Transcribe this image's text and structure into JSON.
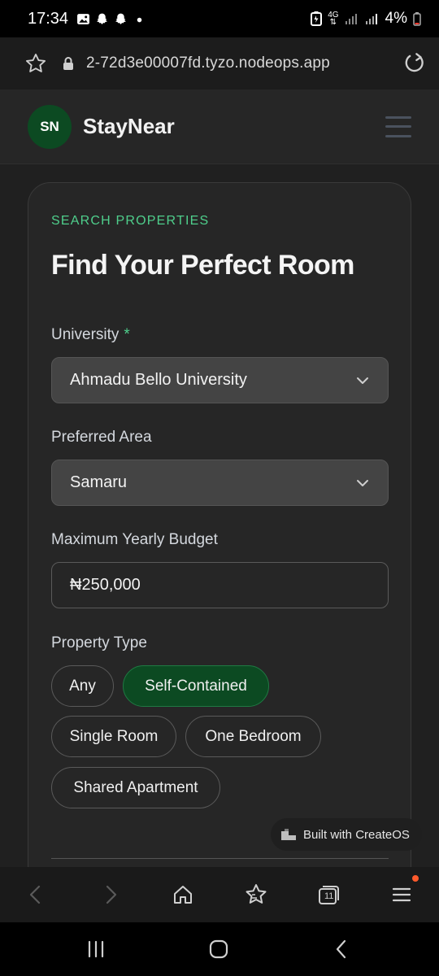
{
  "status_bar": {
    "time": "17:34",
    "battery_percent": "4%",
    "network": "4G"
  },
  "browser": {
    "url": "2-72d3e00007fd.tyzo.nodeops.app"
  },
  "header": {
    "logo_initials": "SN",
    "brand": "StayNear"
  },
  "search": {
    "eyebrow": "SEARCH PROPERTIES",
    "title": "Find Your Perfect Room",
    "university": {
      "label": "University",
      "required_mark": "*",
      "value": "Ahmadu Bello University"
    },
    "area": {
      "label": "Preferred Area",
      "value": "Samaru"
    },
    "budget": {
      "label": "Maximum Yearly Budget",
      "value": "₦250,000"
    },
    "property_type": {
      "label": "Property Type",
      "options": [
        "Any",
        "Self-Contained",
        "Single Room",
        "One Bedroom",
        "Shared Apartment"
      ],
      "selected": "Self-Contained"
    }
  },
  "badge": {
    "text": "Built with CreateOS"
  },
  "browser_toolbar": {
    "tabs_count": "11"
  },
  "colors": {
    "accent": "#4fcf8c",
    "brand_green": "#0c4a22"
  }
}
